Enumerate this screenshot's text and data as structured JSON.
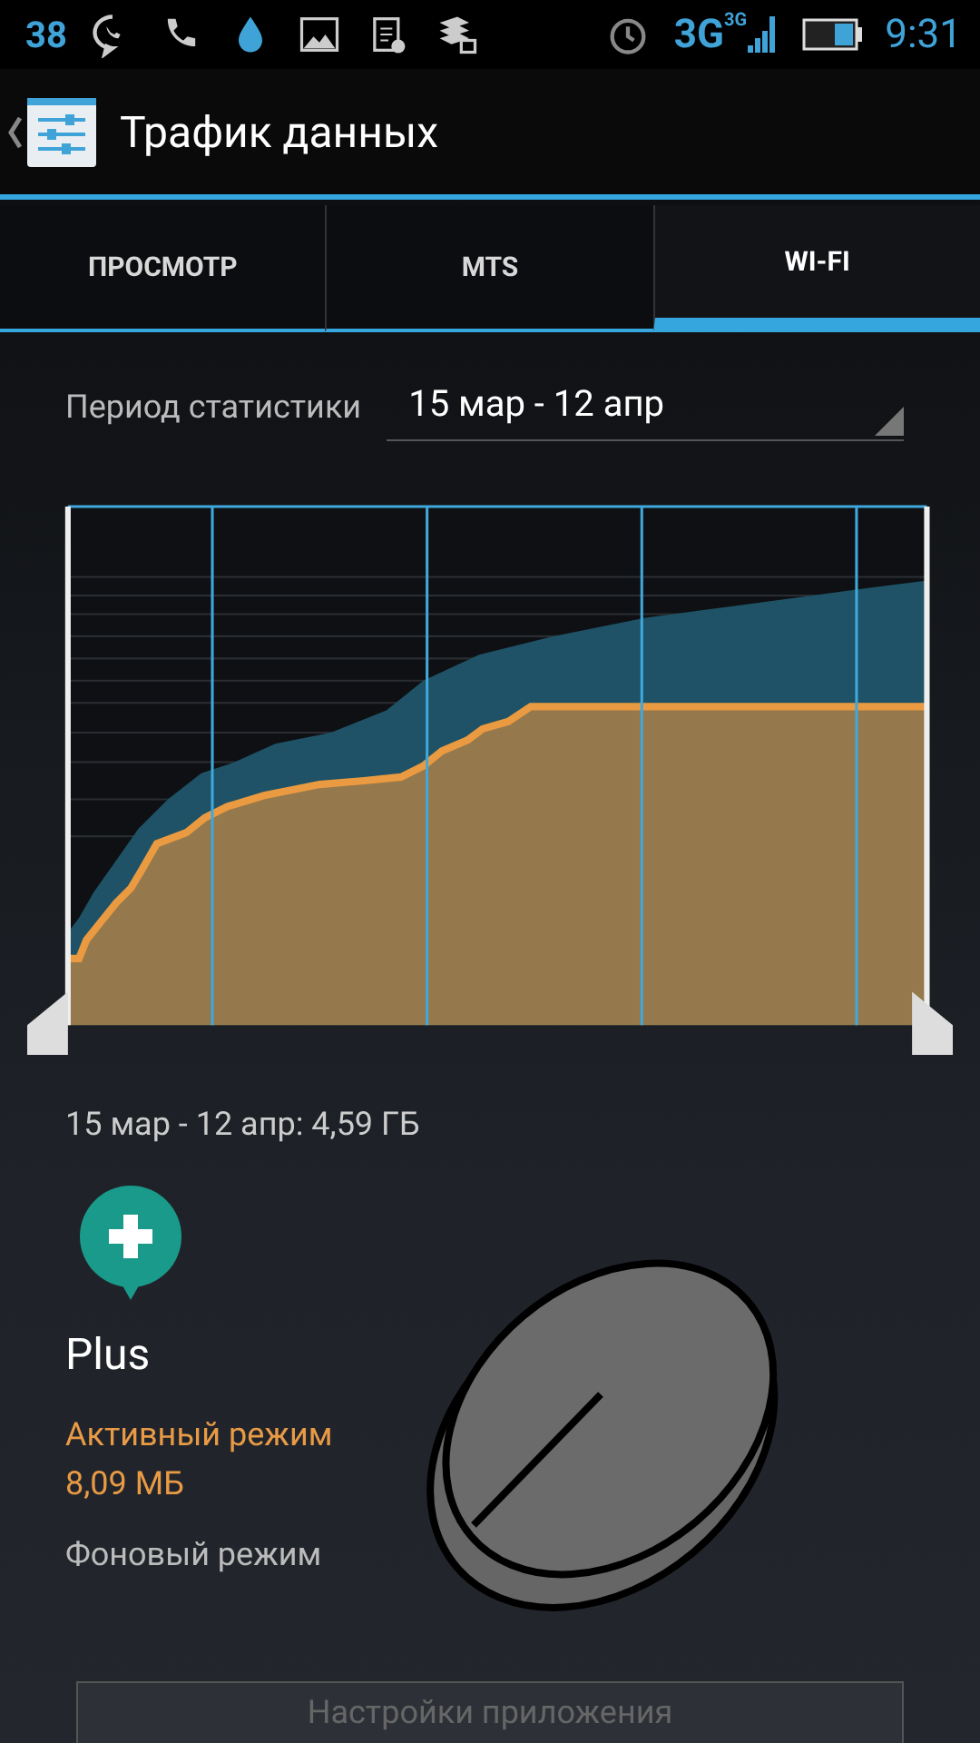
{
  "status_bar": {
    "notification_count": "38",
    "network": "3G",
    "network_small": "3G",
    "time": "9:31"
  },
  "action_bar": {
    "title": "Трафик данных"
  },
  "tabs": [
    {
      "label": "ПРОСМОТР",
      "selected": false
    },
    {
      "label": "MTS",
      "selected": false
    },
    {
      "label": "WI-FI",
      "selected": true
    }
  ],
  "period": {
    "label": "Период статистики",
    "value": "15 мар - 12 апр"
  },
  "summary": "15 мар - 12 апр: 4,59 ГБ",
  "app": {
    "name": "Plus",
    "foreground_label": "Активный режим",
    "foreground_value": "8,09 МБ",
    "background_label": "Фоновый режим"
  },
  "settings_button": {
    "label": "Настройки приложения",
    "disabled": true
  }
}
